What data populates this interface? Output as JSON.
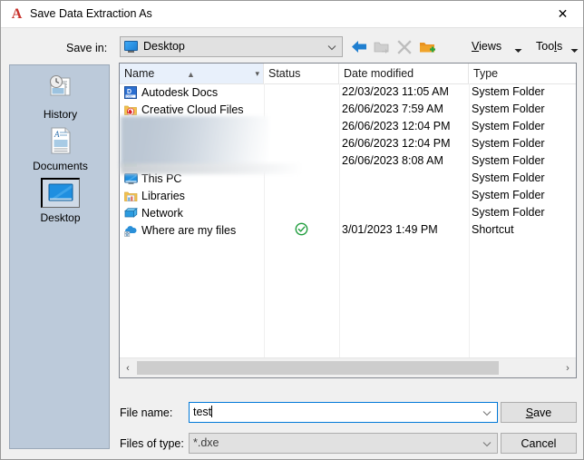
{
  "window": {
    "title": "Save Data Extraction As",
    "app_icon": "autocad-a-icon",
    "close_label": "✕",
    "accent_color": "#0078d7",
    "logo_color": "#c7312b"
  },
  "toolbar": {
    "save_in_label": "Save in:",
    "save_in_value": "Desktop",
    "back_tooltip": "Back",
    "up_tooltip": "Up one level",
    "delete_tooltip": "Delete",
    "new_folder_tooltip": "Create New Folder",
    "views_label": "Views",
    "views_accel": "V",
    "tools_label": "Tools",
    "tools_accel": "l"
  },
  "places": {
    "items": [
      {
        "label": "History",
        "icon": "history-icon",
        "selected": false
      },
      {
        "label": "Documents",
        "icon": "documents-icon",
        "selected": false
      },
      {
        "label": "Desktop",
        "icon": "desktop-icon",
        "selected": true
      }
    ]
  },
  "file_list": {
    "columns": [
      {
        "label": "Name",
        "sort": "ascending"
      },
      {
        "label": "Status"
      },
      {
        "label": "Date modified"
      },
      {
        "label": "Type"
      }
    ],
    "rows": [
      {
        "name": "Autodesk Docs",
        "icon": "autodesk-docs-icon",
        "status": "",
        "date": "22/03/2023 11:05 AM",
        "type": "System Folder",
        "redacted": false
      },
      {
        "name": "Creative Cloud Files",
        "icon": "creative-cloud-icon",
        "status": "",
        "date": "26/06/2023 7:59 AM",
        "type": "System Folder",
        "redacted": false
      },
      {
        "name": "",
        "icon": "folder-icon",
        "status": "",
        "date": "26/06/2023 12:04 PM",
        "type": "System Folder",
        "redacted": true
      },
      {
        "name": "",
        "icon": "folder-icon",
        "status": "",
        "date": "26/06/2023 12:04 PM",
        "type": "System Folder",
        "redacted": true
      },
      {
        "name": "",
        "icon": "folder-icon",
        "status": "",
        "date": "26/06/2023 8:08 AM",
        "type": "System Folder",
        "redacted": true
      },
      {
        "name": "This PC",
        "icon": "this-pc-icon",
        "status": "",
        "date": "",
        "type": "System Folder",
        "redacted": false
      },
      {
        "name": "Libraries",
        "icon": "libraries-icon",
        "status": "",
        "date": "",
        "type": "System Folder",
        "redacted": false
      },
      {
        "name": "Network",
        "icon": "network-icon",
        "status": "",
        "date": "",
        "type": "System Folder",
        "redacted": false
      },
      {
        "name": "Where are my files",
        "icon": "cloud-shortcut-icon",
        "status": "synced-check-icon",
        "date": "3/01/2023 1:49 PM",
        "type": "Shortcut",
        "redacted": false
      }
    ],
    "scrollbar": {
      "left_arrow": "‹",
      "right_arrow": "›"
    }
  },
  "footer": {
    "filename_label": "File name:",
    "filename_value": "test",
    "filetype_label": "Files of type:",
    "filetype_value": "*.dxe",
    "save_label": "Save",
    "save_accel": "S",
    "cancel_label": "Cancel"
  }
}
